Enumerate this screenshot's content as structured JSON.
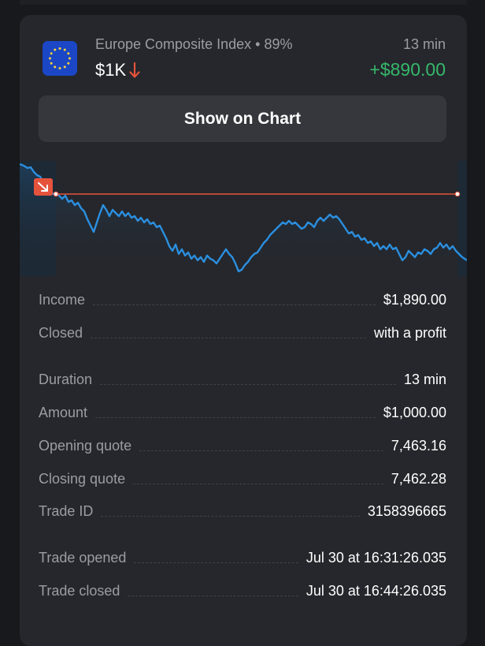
{
  "trade": {
    "asset_name": "Europe Composite Index",
    "payout": "89%",
    "amount_short": "$1K",
    "duration_short": "13 min",
    "profit": "+$890.00",
    "flag_icon": "eu-flag-icon",
    "direction_icon": "arrow-down-icon"
  },
  "buttons": {
    "show_on_chart": "Show on Chart"
  },
  "colors": {
    "page_bg": "#18191c",
    "card_bg": "#25272c",
    "button_bg": "#35373c",
    "profit_green": "#36b86b",
    "down_red": "#e5533c",
    "chart_line": "#2b8fe0",
    "muted_text": "#9a9da3"
  },
  "details": [
    {
      "label": "Income",
      "value": "$1,890.00"
    },
    {
      "label": "Closed",
      "value": "with a profit"
    },
    {
      "label": "Duration",
      "value": "13 min"
    },
    {
      "label": "Amount",
      "value": "$1,000.00"
    },
    {
      "label": "Opening quote",
      "value": "7,463.16"
    },
    {
      "label": "Closing quote",
      "value": "7,462.28"
    },
    {
      "label": "Trade ID",
      "value": "3158396665"
    },
    {
      "label": "Trade opened",
      "value": "Jul 30 at 16:31:26.035"
    },
    {
      "label": "Trade closed",
      "value": "Jul 30 at 16:44:26.035"
    }
  ]
}
